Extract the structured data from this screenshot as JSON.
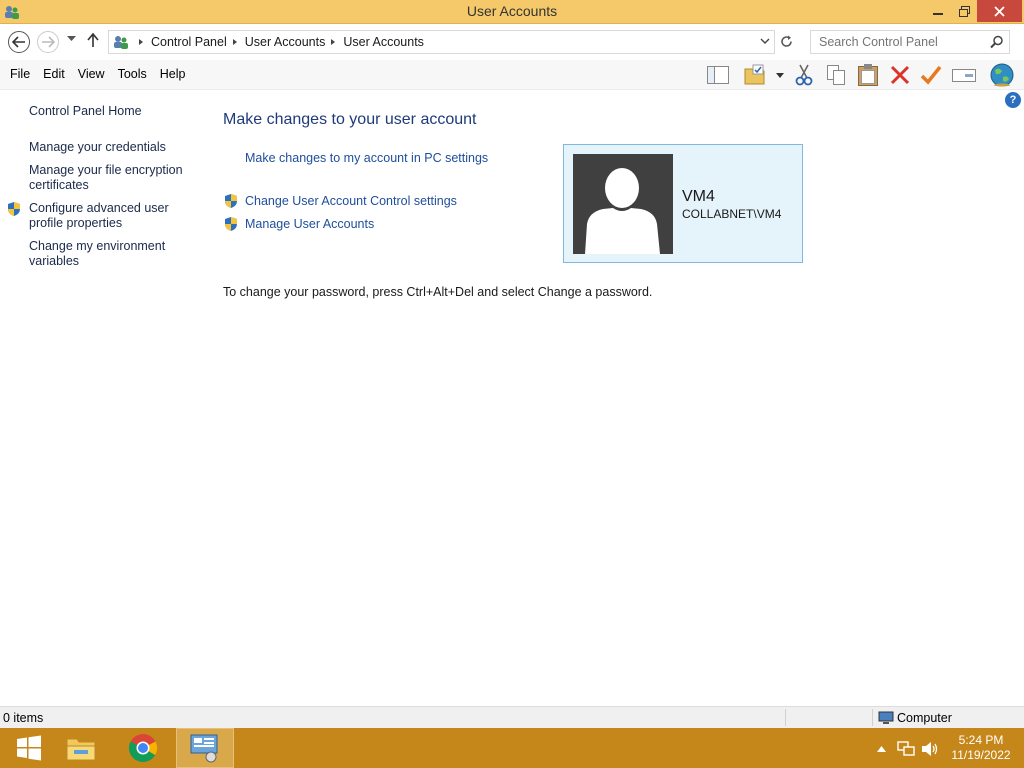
{
  "window": {
    "title": "User Accounts",
    "minimize": "–",
    "maximize": "❐",
    "close": "✕"
  },
  "address": {
    "breadcrumbs": [
      "Control Panel",
      "User Accounts",
      "User Accounts"
    ],
    "search_placeholder": "Search Control Panel"
  },
  "menu": [
    "File",
    "Edit",
    "View",
    "Tools",
    "Help"
  ],
  "toolbar_icons": [
    "layout-pane-icon",
    "folder-properties-icon",
    "cut-icon",
    "copy-icon",
    "paste-icon",
    "delete-icon",
    "check-icon",
    "rename-icon",
    "globe-icon"
  ],
  "sidebar": {
    "items": [
      {
        "label": "Control Panel Home",
        "shield": false
      },
      {
        "label": "Manage your credentials",
        "shield": false
      },
      {
        "label": "Manage your file encryption certificates",
        "shield": false
      },
      {
        "label": "Configure advanced user profile properties",
        "shield": true
      },
      {
        "label": "Change my environment variables",
        "shield": false
      }
    ]
  },
  "main": {
    "title": "Make changes to your user account",
    "links": [
      {
        "label": "Make changes to my account in PC settings",
        "shield": false
      },
      {
        "label": "Change User Account Control settings",
        "shield": true
      },
      {
        "label": "Manage User Accounts",
        "shield": true
      }
    ],
    "password_note": "To change your password, press Ctrl+Alt+Del and select Change a password."
  },
  "account": {
    "name": "VM4",
    "domain": "COLLABNET\\VM4"
  },
  "help": "?",
  "status": {
    "items": "0 items",
    "location": "Computer"
  },
  "taskbar": {
    "apps": [
      "windows-start-icon",
      "file-explorer-icon",
      "chrome-icon",
      "control-panel-icon"
    ],
    "time": "5:24 PM",
    "date": "11/19/2022"
  },
  "colors": {
    "titlebar": "#f5c96a",
    "taskbar": "#c6871a",
    "link": "#1e4e9b",
    "heading": "#1e3a7b",
    "card": "#e5f3fb"
  }
}
